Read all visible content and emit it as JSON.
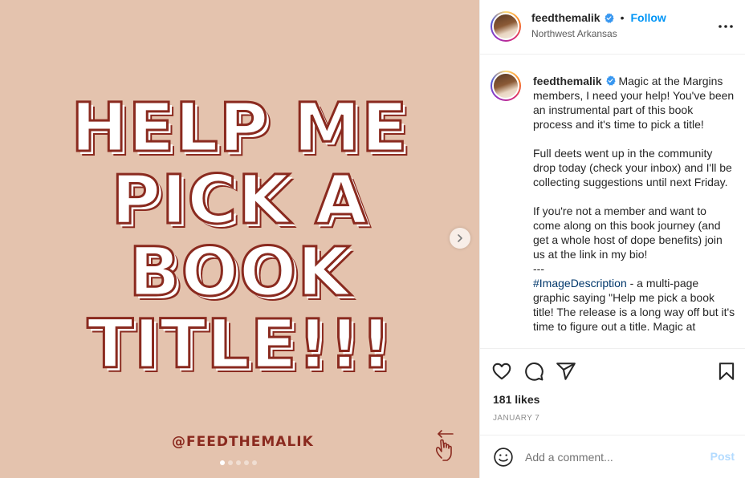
{
  "media": {
    "headline_lines": [
      "HELP ME",
      "PICK A",
      "BOOK",
      "TITLE!!!"
    ],
    "watermark_handle": "@FEEDTHEMALIK",
    "carousel_total": 5,
    "carousel_active_index": 0,
    "swipe_icon": "swipe-left-hand-icon",
    "next_icon": "chevron-right-icon",
    "colors": {
      "background": "#e4c3ae",
      "text_outline": "#8a2a1f",
      "text_fill": "#ffffff"
    }
  },
  "header": {
    "username": "feedthemalik",
    "separator": "•",
    "follow_label": "Follow",
    "location": "Northwest Arkansas",
    "verified_icon": "verified-badge-icon",
    "more_icon": "more-options-icon"
  },
  "caption": {
    "username": "feedthemalik",
    "text_before_hashtag": " Magic at the Margins members, I need your help! You've been an instrumental part of this book process and it's time to pick a title!\n\nFull deets went up in the community drop today (check your inbox) and I'll be collecting suggestions until next Friday.\n\nIf you're not a member and want to come along on this book journey (and get a whole host of dope benefits) join us at the link in my bio!\n---\n",
    "hashtag": "#ImageDescription",
    "text_after_hashtag": " - a multi-page graphic saying \"Help me pick a book title! The release is a long way off but it's time to figure out a title. Magic at"
  },
  "actions": {
    "like_icon": "heart-icon",
    "comment_icon": "comment-icon",
    "share_icon": "share-icon",
    "save_icon": "bookmark-icon",
    "likes_text": "181 likes",
    "date_text": "JANUARY 7"
  },
  "comment": {
    "emoji_icon": "emoji-icon",
    "placeholder": "Add a comment...",
    "post_label": "Post",
    "post_color": "#b3dbff",
    "accent": "#0095f6"
  }
}
